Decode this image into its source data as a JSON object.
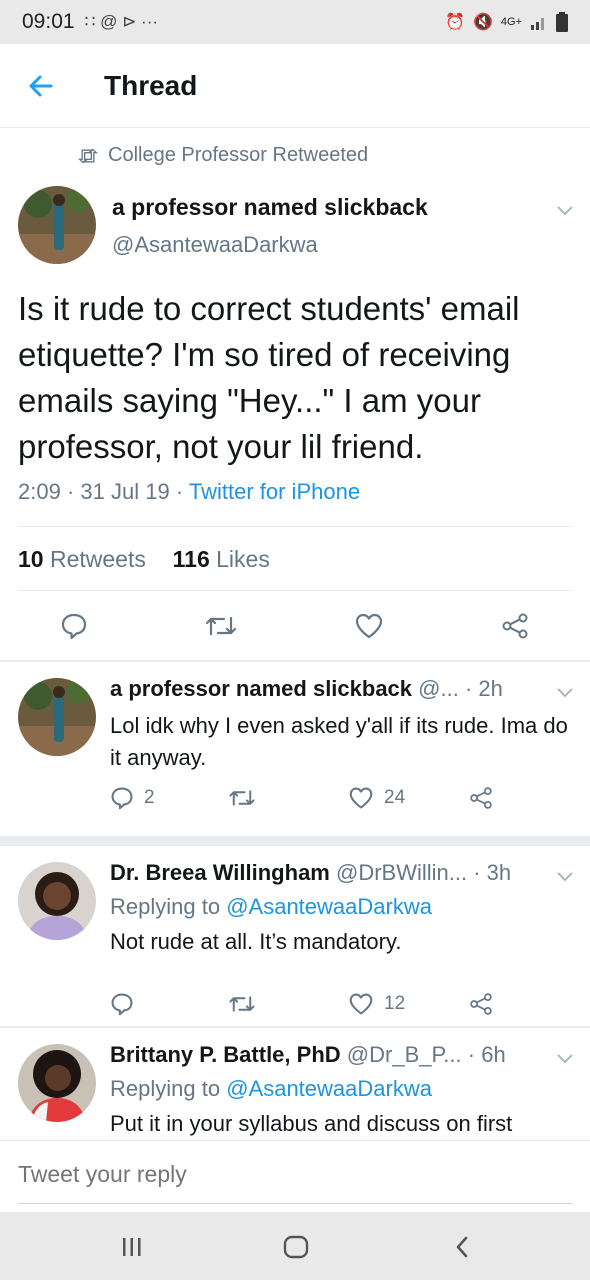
{
  "status_bar": {
    "time": "09:01",
    "left_icons": "∷ @ ⊳ ···",
    "network": "4G+"
  },
  "header": {
    "title": "Thread"
  },
  "main_tweet": {
    "retweeted_by": "College Professor Retweeted",
    "name": "a professor named slickback",
    "handle": "@AsantewaaDarkwa",
    "text": "Is it rude to correct students' email etiquette? I'm so tired of receiving emails saying \"Hey...\" I am your professor, not your lil friend.",
    "time": "2:09",
    "date": "31 Jul 19",
    "source": "Twitter for iPhone",
    "retweets_count": "10",
    "retweets_label": "Retweets",
    "likes_count": "116",
    "likes_label": "Likes"
  },
  "replies": [
    {
      "name": "a professor named slickback",
      "handle": "@...",
      "time": "· 2h",
      "replying_to": "",
      "text": "Lol idk why I even asked y'all if its rude. Ima do it anyway.",
      "reply_count": "2",
      "retweet_count": "",
      "like_count": "24"
    },
    {
      "name": "Dr. Breea Willingham",
      "handle": "@DrBWillin...",
      "time": "· 3h",
      "replying_to_label": "Replying to",
      "replying_to": "@AsantewaaDarkwa",
      "text": "Not rude at all. It’s mandatory.",
      "reply_count": "",
      "retweet_count": "",
      "like_count": "12"
    },
    {
      "name": "Brittany P. Battle, PhD",
      "handle": "@Dr_B_P...",
      "time": "· 6h",
      "replying_to_label": "Replying to",
      "replying_to": "@AsantewaaDarkwa",
      "text": "Put it in your syllabus and discuss on first"
    }
  ],
  "compose": {
    "placeholder": "Tweet your reply"
  },
  "colors": {
    "accent": "#1b95e0",
    "secondary_text": "#657786",
    "separator": "#e6ecf0"
  }
}
